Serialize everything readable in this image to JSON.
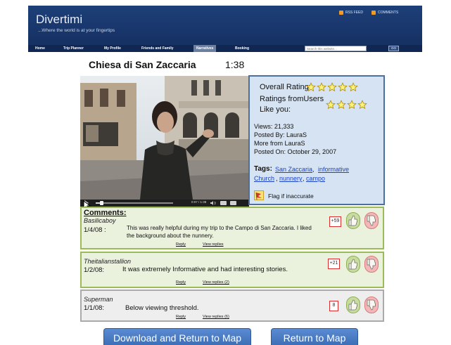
{
  "header": {
    "logo": "Divertimi",
    "tagline": "...Where the world is at your fingertips",
    "rss_feed": "RSS FEED",
    "comments_feed": "COMMENTS",
    "nav": [
      "Home",
      "Trip Planner",
      "My Profile",
      "Friends and Family",
      "Narratives",
      "Booking"
    ],
    "active_nav": "Narratives",
    "search_placeholder": "Search this website...",
    "go": "GO"
  },
  "video": {
    "title": "Chiesa di San Zaccaria",
    "duration": "1:38",
    "time_code": "0:07 / 1:38",
    "progress_fraction": 0.07
  },
  "info": {
    "overall_label": "Overall Rating:",
    "overall_stars": 5,
    "users_label_1": "Ratings fromUsers",
    "users_label_2": "Like you:",
    "users_stars": 4,
    "views": "Views: 21,333",
    "posted_by": "Posted By: LauraS",
    "more_from": "More from LauraS",
    "posted_on": "Posted On: October 29, 2007",
    "tags_label": "Tags:",
    "tags": [
      "San Zaccaria",
      "informative",
      "Church",
      "nunnery",
      "campo"
    ],
    "flag": "Flag if inaccurate"
  },
  "comments": {
    "heading": "Comments:",
    "items": [
      {
        "author": "Basilicaboy",
        "date": "1/4/08 :",
        "text_line_1": "This was really helpful during my trip to the Campo di San Zaccaria. I liked",
        "text_line_2": "the background about the nunnery.",
        "reply": "Reply",
        "view_replies": "View replies",
        "score": "+59"
      },
      {
        "author": "Theitalianstallion",
        "date": "1/2/08:",
        "text_line_1": "It was extremely Informative and had interesting stories.",
        "reply": "Reply",
        "view_replies": "View replies (2)",
        "score": "+21"
      },
      {
        "author": "Superman",
        "date": "1/1/08:",
        "text_line_1": "Below viewing threshold.",
        "reply": "Reply",
        "view_replies": "View replies (6)",
        "score": "8"
      }
    ]
  },
  "buttons": {
    "download": "Download and Return to Map",
    "return": "Return to Map"
  },
  "colors": {
    "header_bg": "#1d3f78",
    "info_bg": "#d6e3f2",
    "comment_bg": "#eaf1dd",
    "comment_border": "#9bbb59",
    "button_bg": "#4a7cc4"
  },
  "icons": [
    "rss-feed-icon",
    "comments-feed-icon",
    "play-icon",
    "volume-icon",
    "fullscreen-icon",
    "star-icon",
    "flag-icon",
    "thumbs-up-icon",
    "thumbs-down-icon",
    "cursor-pointer-icon"
  ]
}
